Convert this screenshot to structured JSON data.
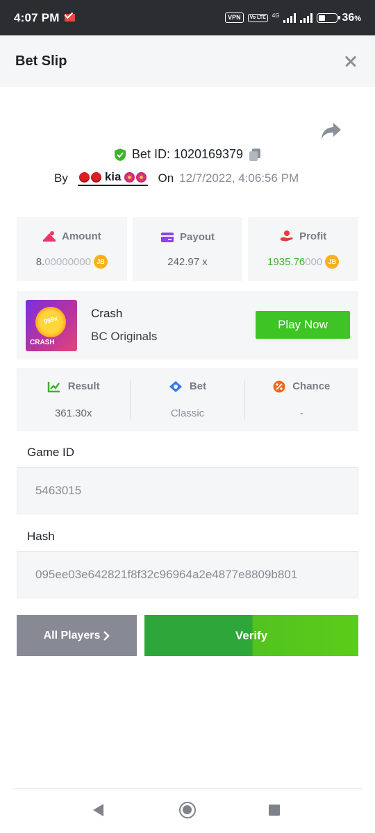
{
  "status_bar": {
    "time": "4:07 PM",
    "vpn_label": "VPN",
    "volte_label": "Vo LTE",
    "network_label": "4G",
    "battery_percent": "36",
    "battery_unit": "%",
    "battery_level": 0.36
  },
  "header": {
    "title": "Bet Slip"
  },
  "bet": {
    "bet_id_prefix": "Bet ID: ",
    "bet_id": "1020169379",
    "by_label": "By",
    "username": "kia",
    "on_label": "On",
    "datetime": "12/7/2022, 4:06:56 PM"
  },
  "stats": {
    "amount": {
      "label": "Amount",
      "value_main": "8.",
      "value_dim": "00000000",
      "currency": "JB"
    },
    "payout": {
      "label": "Payout",
      "value": "242.97 x"
    },
    "profit": {
      "label": "Profit",
      "value_main": "1935.76",
      "value_dim": "000",
      "currency": "JB"
    }
  },
  "game": {
    "name": "Crash",
    "provider": "BC Originals",
    "thumb_badge": "999x",
    "thumb_text": "CRASH",
    "play_label": "Play Now"
  },
  "results": {
    "result": {
      "label": "Result",
      "value": "361.30x"
    },
    "bet": {
      "label": "Bet",
      "value": "Classic"
    },
    "chance": {
      "label": "Chance",
      "value": "-"
    }
  },
  "fields": {
    "game_id_label": "Game ID",
    "game_id_value": "5463015",
    "hash_label": "Hash",
    "hash_value": "095ee03e642821f8f32c96964a2e4877e8809b801"
  },
  "actions": {
    "all_players_label": "All Players",
    "verify_label": "Verify"
  },
  "colors": {
    "accent_green": "#3ec424",
    "profit_green": "#3cb32a",
    "coin": "#f5b21e",
    "panel_bg": "#f5f6f7"
  }
}
